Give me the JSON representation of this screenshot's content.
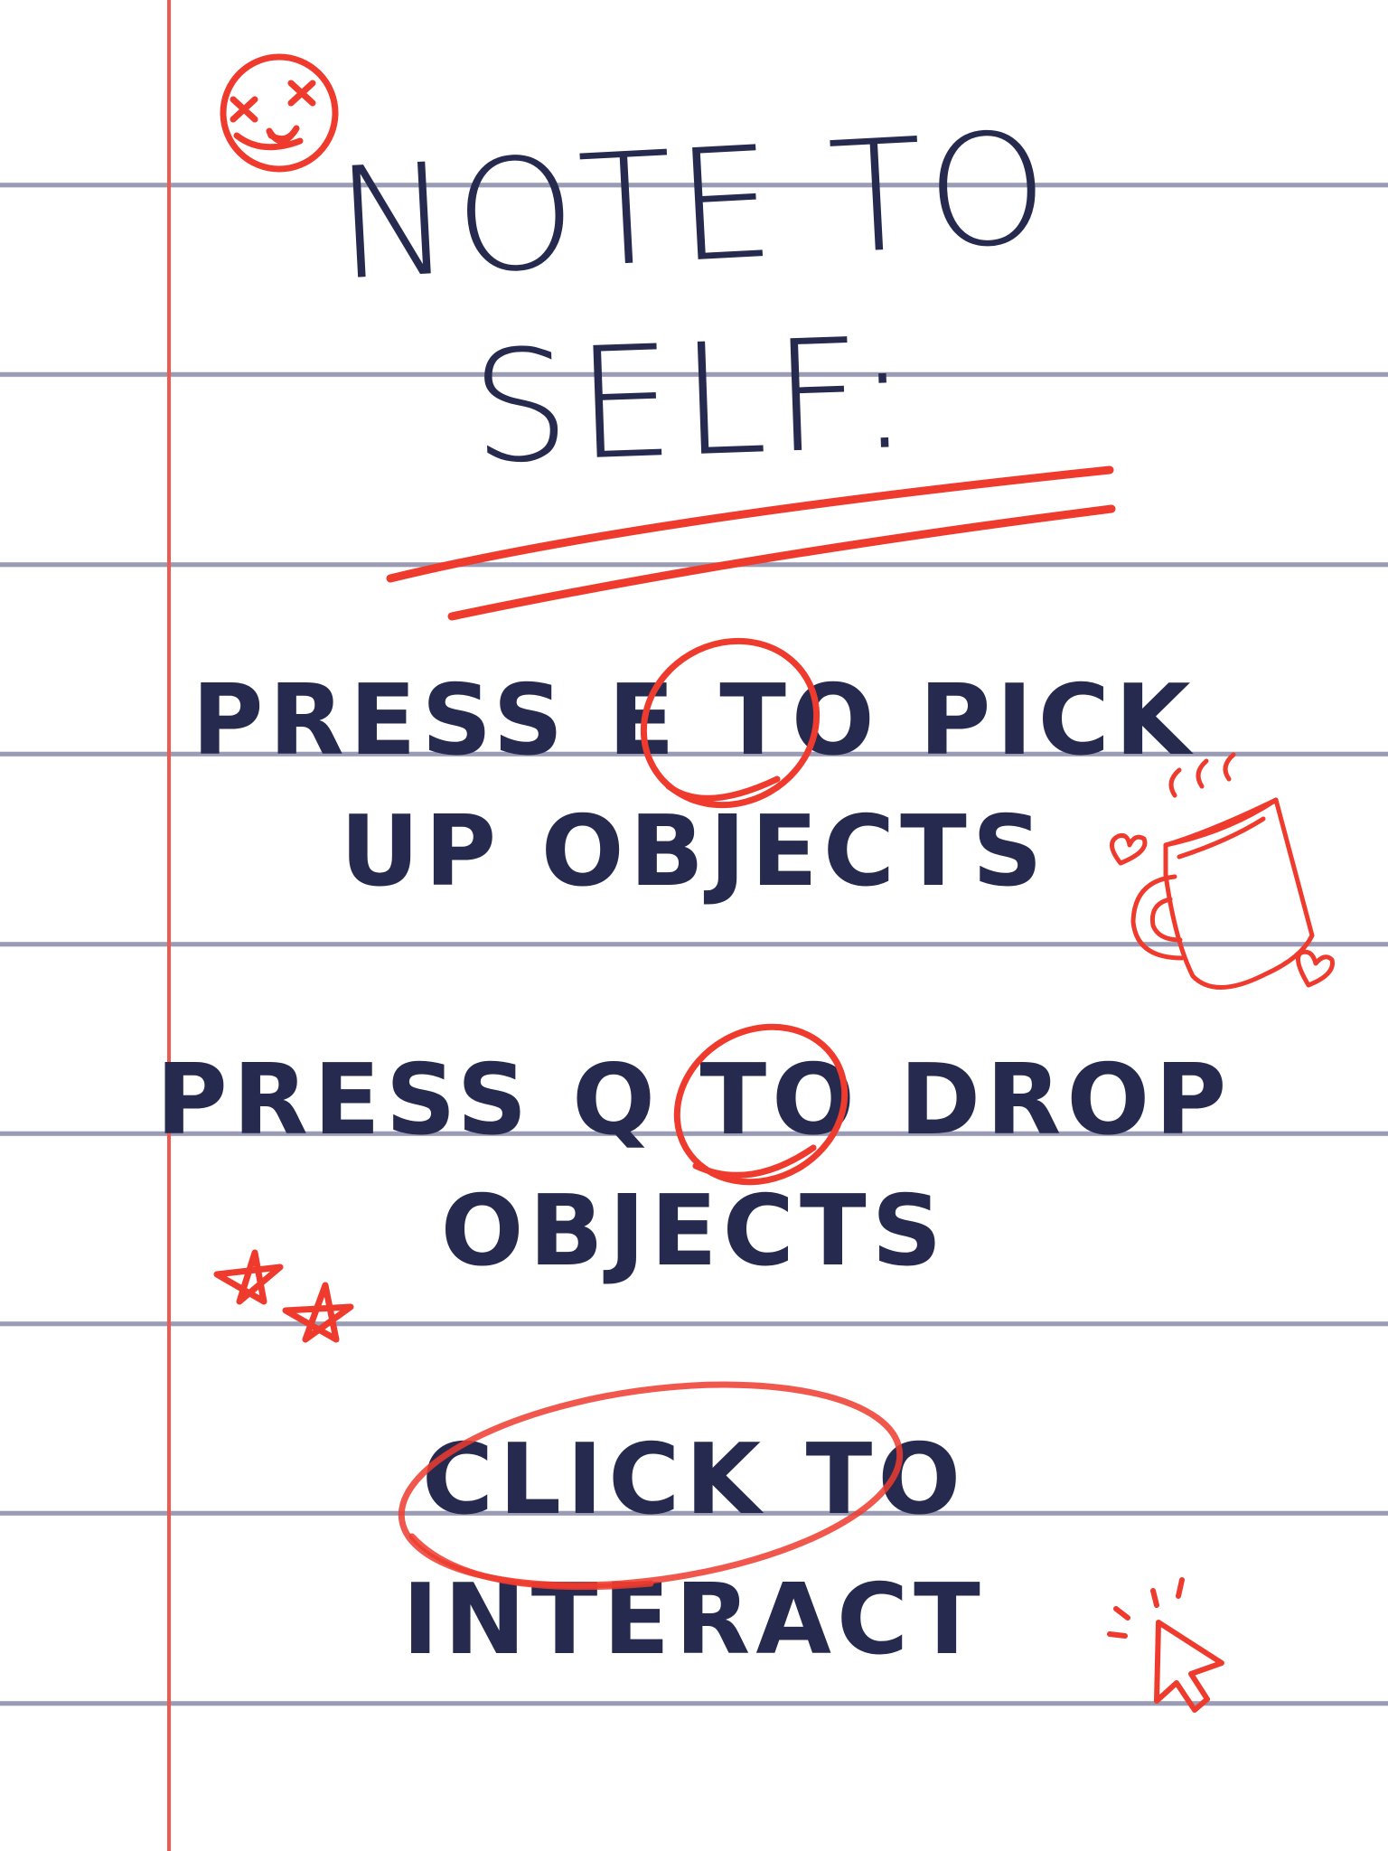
{
  "note": {
    "title_line_1": "NOTE TO",
    "title_line_2": "SELF:",
    "instructions": [
      {
        "line_1": "PRESS E TO PICK",
        "line_2": "UP OBJECTS",
        "key": "E"
      },
      {
        "line_1": "PRESS Q TO DROP",
        "line_2": "OBJECTS",
        "key": "Q"
      },
      {
        "line_1": "CLICK TO",
        "line_2": "INTERACT",
        "key": "CLICK"
      }
    ]
  },
  "colors": {
    "ink": "#262a4f",
    "accent_red": "#ee3b2e",
    "margin_red": "#ee5a50",
    "rule_lines": "#9a9bb4",
    "paper": "#ffffff"
  },
  "doodles": [
    "dizzy-face-icon",
    "coffee-mug-icon",
    "heart-icon",
    "star-icon",
    "cursor-arrow-icon"
  ]
}
